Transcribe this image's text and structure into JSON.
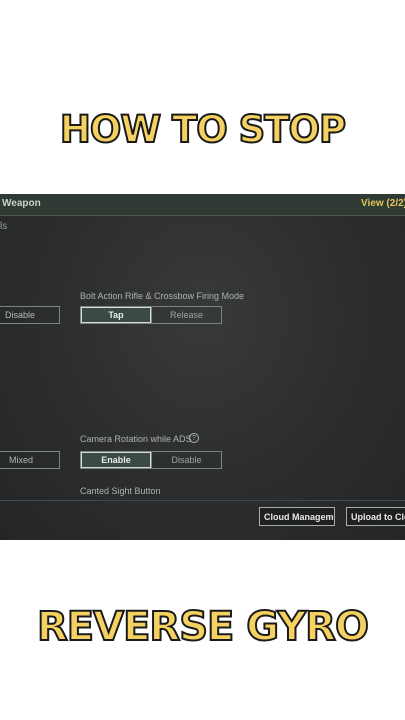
{
  "headline_top": "HOW TO STOP",
  "headline_bottom": "REVERSE GYRO",
  "panel": {
    "header_left": "Weapon",
    "header_right": "View (2/2)",
    "sub_label": "ls",
    "row1": {
      "left_option": "Disable",
      "setting_label": "Bolt Action Rifle & Crossbow Firing Mode",
      "options": [
        "Tap",
        "Release"
      ],
      "selected": "Tap"
    },
    "row2": {
      "left_option": "Mixed",
      "setting_label": "Camera Rotation while ADS",
      "help_icon": "?",
      "options": [
        "Enable",
        "Disable"
      ],
      "selected": "Enable"
    },
    "row3_label": "Canted Sight Button",
    "footer": {
      "cloud_management": "Cloud Management",
      "upload": "Upload to Clo"
    }
  },
  "colors": {
    "headline_fill": "#f4d160",
    "header_accent": "#e2c458",
    "panel_bg": "#2b2d2f"
  }
}
